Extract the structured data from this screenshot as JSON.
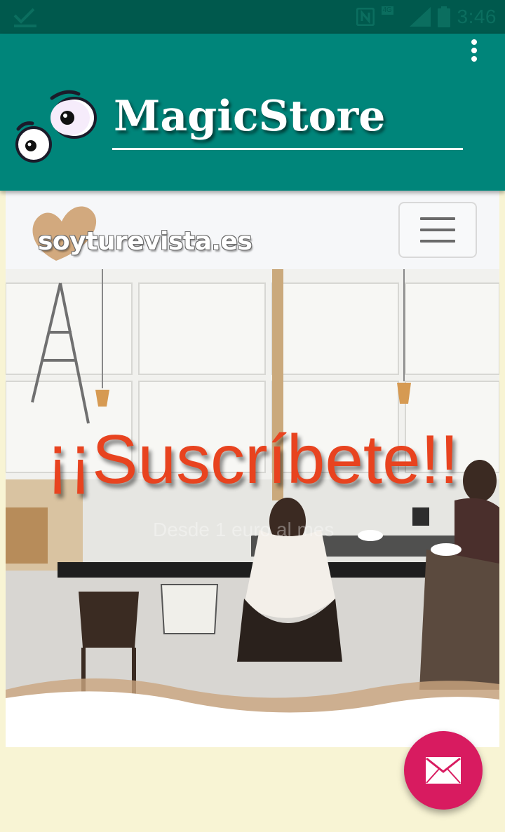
{
  "status_bar": {
    "time": "3:46",
    "network": "4G",
    "icons": [
      "check-icon",
      "nfc-icon",
      "signal-icon",
      "battery-icon"
    ]
  },
  "app_bar": {
    "title": "MagicStore",
    "logo": "googly-eyes-logo",
    "menu_icon": "overflow-menu-icon",
    "color": "#00857a"
  },
  "site": {
    "logo_text": "soyturevista.es",
    "menu_icon": "hamburger-menu-icon",
    "hero": {
      "title": "¡¡Suscríbete!!",
      "subtitle": "Desde 1 euro al mes",
      "title_color": "#e8431f"
    }
  },
  "fab": {
    "icon": "mail-icon",
    "color": "#d81b60"
  }
}
